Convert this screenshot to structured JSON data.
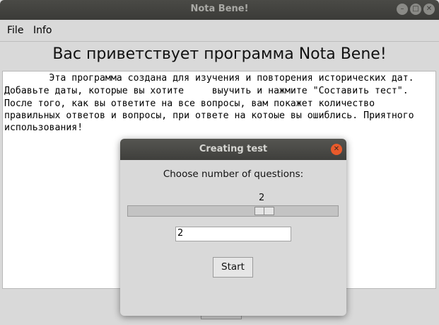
{
  "window": {
    "title": "Nota Bene!",
    "buttons": [
      "minimize-icon",
      "maximize-icon",
      "close-icon"
    ]
  },
  "menubar": {
    "items": [
      {
        "label": "File"
      },
      {
        "label": "Info"
      }
    ]
  },
  "main": {
    "heading": "Вас приветствует программа Nota Bene!",
    "text_lines": [
      "        Эта программа создана для изучения и повторения исторических дат.",
      "Добавьте даты, которые вы хотите     выучить и нажмите \"Составить тест\".",
      "После того, как вы ответите на все вопросы, вам покажет количество",
      "правильных ответов и вопросы, при ответе на котоые вы ошиблись. Приятного",
      "использования!"
    ]
  },
  "dialog": {
    "title": "Creating test",
    "prompt": "Choose number of questions:",
    "scale": {
      "value": "2",
      "level": 0.65
    },
    "entry_value": "2",
    "start_label": "Start"
  },
  "colors": {
    "titlebar": "#3c3c39",
    "dialog_close": "#e95a2b",
    "window_bg": "#d9d9d9"
  }
}
